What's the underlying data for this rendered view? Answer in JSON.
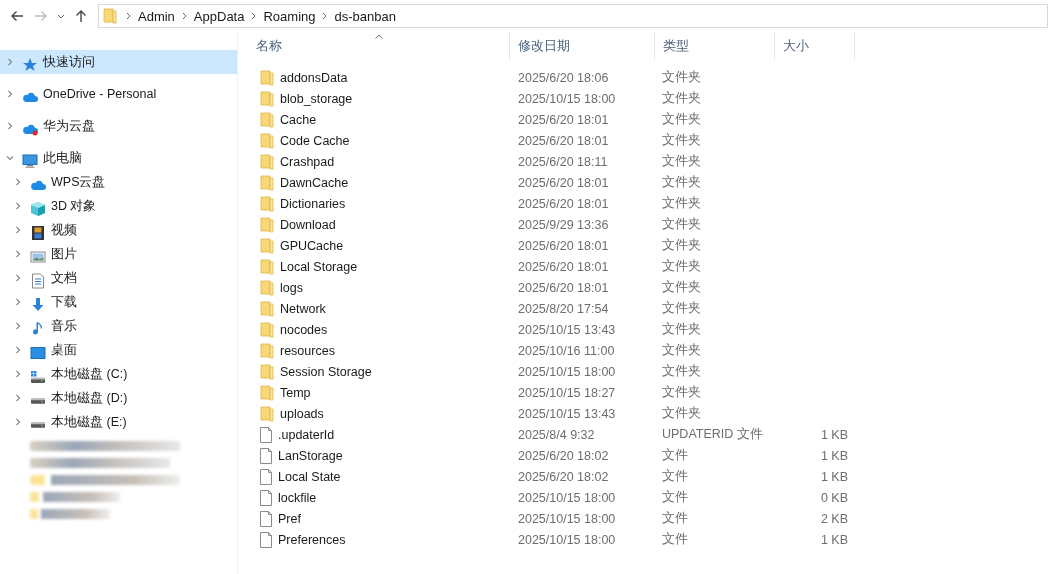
{
  "navigation": {
    "back_disabled": false,
    "forward_disabled": true,
    "breadcrumb": [
      "Admin",
      "AppData",
      "Roaming",
      "ds-banban"
    ]
  },
  "sidebar": {
    "items": [
      {
        "label": "快速访问",
        "kind": "star",
        "selected": true,
        "expanded": false
      },
      {
        "label": "OneDrive - Personal",
        "kind": "cloud",
        "selected": false,
        "expanded": false
      },
      {
        "label": "华为云盘",
        "kind": "cloud-red",
        "selected": false,
        "expanded": false
      },
      {
        "label": "此电脑",
        "kind": "pc",
        "selected": false,
        "expanded": true,
        "children": [
          {
            "label": "WPS云盘",
            "kind": "cloud",
            "selected": false,
            "expanded": false
          },
          {
            "label": "3D 对象",
            "kind": "cube",
            "selected": false,
            "expanded": false
          },
          {
            "label": "视频",
            "kind": "film",
            "selected": false,
            "expanded": false
          },
          {
            "label": "图片",
            "kind": "picture",
            "selected": false,
            "expanded": false
          },
          {
            "label": "文档",
            "kind": "document",
            "selected": false,
            "expanded": false
          },
          {
            "label": "下载",
            "kind": "download",
            "selected": false,
            "expanded": false
          },
          {
            "label": "音乐",
            "kind": "music",
            "selected": false,
            "expanded": false
          },
          {
            "label": "桌面",
            "kind": "desktop",
            "selected": false,
            "expanded": false
          },
          {
            "label": "本地磁盘 (C:)",
            "kind": "drive-windows",
            "selected": false,
            "expanded": false
          },
          {
            "label": "本地磁盘 (D:)",
            "kind": "drive",
            "selected": false,
            "expanded": false
          },
          {
            "label": "本地磁盘 (E:)",
            "kind": "drive",
            "selected": false,
            "expanded": false
          }
        ]
      }
    ]
  },
  "table": {
    "columns": [
      {
        "label": "名称",
        "sorted": true
      },
      {
        "label": "修改日期",
        "sorted": false
      },
      {
        "label": "类型",
        "sorted": false
      },
      {
        "label": "大小",
        "sorted": false
      }
    ],
    "rows": [
      {
        "kind": "folder",
        "name": "addonsData",
        "modified": "2025/6/20 18:06",
        "type": "文件夹"
      },
      {
        "kind": "folder",
        "name": "blob_storage",
        "modified": "2025/10/15 18:00",
        "type": "文件夹"
      },
      {
        "kind": "folder",
        "name": "Cache",
        "modified": "2025/6/20 18:01",
        "type": "文件夹"
      },
      {
        "kind": "folder",
        "name": "Code Cache",
        "modified": "2025/6/20 18:01",
        "type": "文件夹"
      },
      {
        "kind": "folder",
        "name": "Crashpad",
        "modified": "2025/6/20 18:11",
        "type": "文件夹"
      },
      {
        "kind": "folder",
        "name": "DawnCache",
        "modified": "2025/6/20 18:01",
        "type": "文件夹"
      },
      {
        "kind": "folder",
        "name": "Dictionaries",
        "modified": "2025/6/20 18:01",
        "type": "文件夹"
      },
      {
        "kind": "folder",
        "name": "Download",
        "modified": "2025/9/29 13:36",
        "type": "文件夹"
      },
      {
        "kind": "folder",
        "name": "GPUCache",
        "modified": "2025/6/20 18:01",
        "type": "文件夹"
      },
      {
        "kind": "folder",
        "name": "Local Storage",
        "modified": "2025/6/20 18:01",
        "type": "文件夹"
      },
      {
        "kind": "folder",
        "name": "logs",
        "modified": "2025/6/20 18:01",
        "type": "文件夹"
      },
      {
        "kind": "folder",
        "name": "Network",
        "modified": "2025/8/20 17:54",
        "type": "文件夹"
      },
      {
        "kind": "folder",
        "name": "nocodes",
        "modified": "2025/10/15 13:43",
        "type": "文件夹"
      },
      {
        "kind": "folder",
        "name": "resources",
        "modified": "2025/10/16 11:00",
        "type": "文件夹"
      },
      {
        "kind": "folder",
        "name": "Session Storage",
        "modified": "2025/10/15 18:00",
        "type": "文件夹"
      },
      {
        "kind": "folder",
        "name": "Temp",
        "modified": "2025/10/15 18:27",
        "type": "文件夹"
      },
      {
        "kind": "folder",
        "name": "uploads",
        "modified": "2025/10/15 13:43",
        "type": "文件夹"
      },
      {
        "kind": "file",
        "name": ".updaterId",
        "modified": "2025/8/4 9:32",
        "type": "UPDATERID 文件",
        "size": "1 KB"
      },
      {
        "kind": "file",
        "name": "LanStorage",
        "modified": "2025/6/20 18:02",
        "type": "文件",
        "size": "1 KB"
      },
      {
        "kind": "file",
        "name": "Local State",
        "modified": "2025/6/20 18:02",
        "type": "文件",
        "size": "1 KB"
      },
      {
        "kind": "file",
        "name": "lockfile",
        "modified": "2025/10/15 18:00",
        "type": "文件",
        "size": "0 KB"
      },
      {
        "kind": "file",
        "name": "Pref",
        "modified": "2025/10/15 18:00",
        "type": "文件",
        "size": "2 KB"
      },
      {
        "kind": "file",
        "name": "Preferences",
        "modified": "2025/10/15 18:00",
        "type": "文件",
        "size": "1 KB"
      }
    ]
  }
}
